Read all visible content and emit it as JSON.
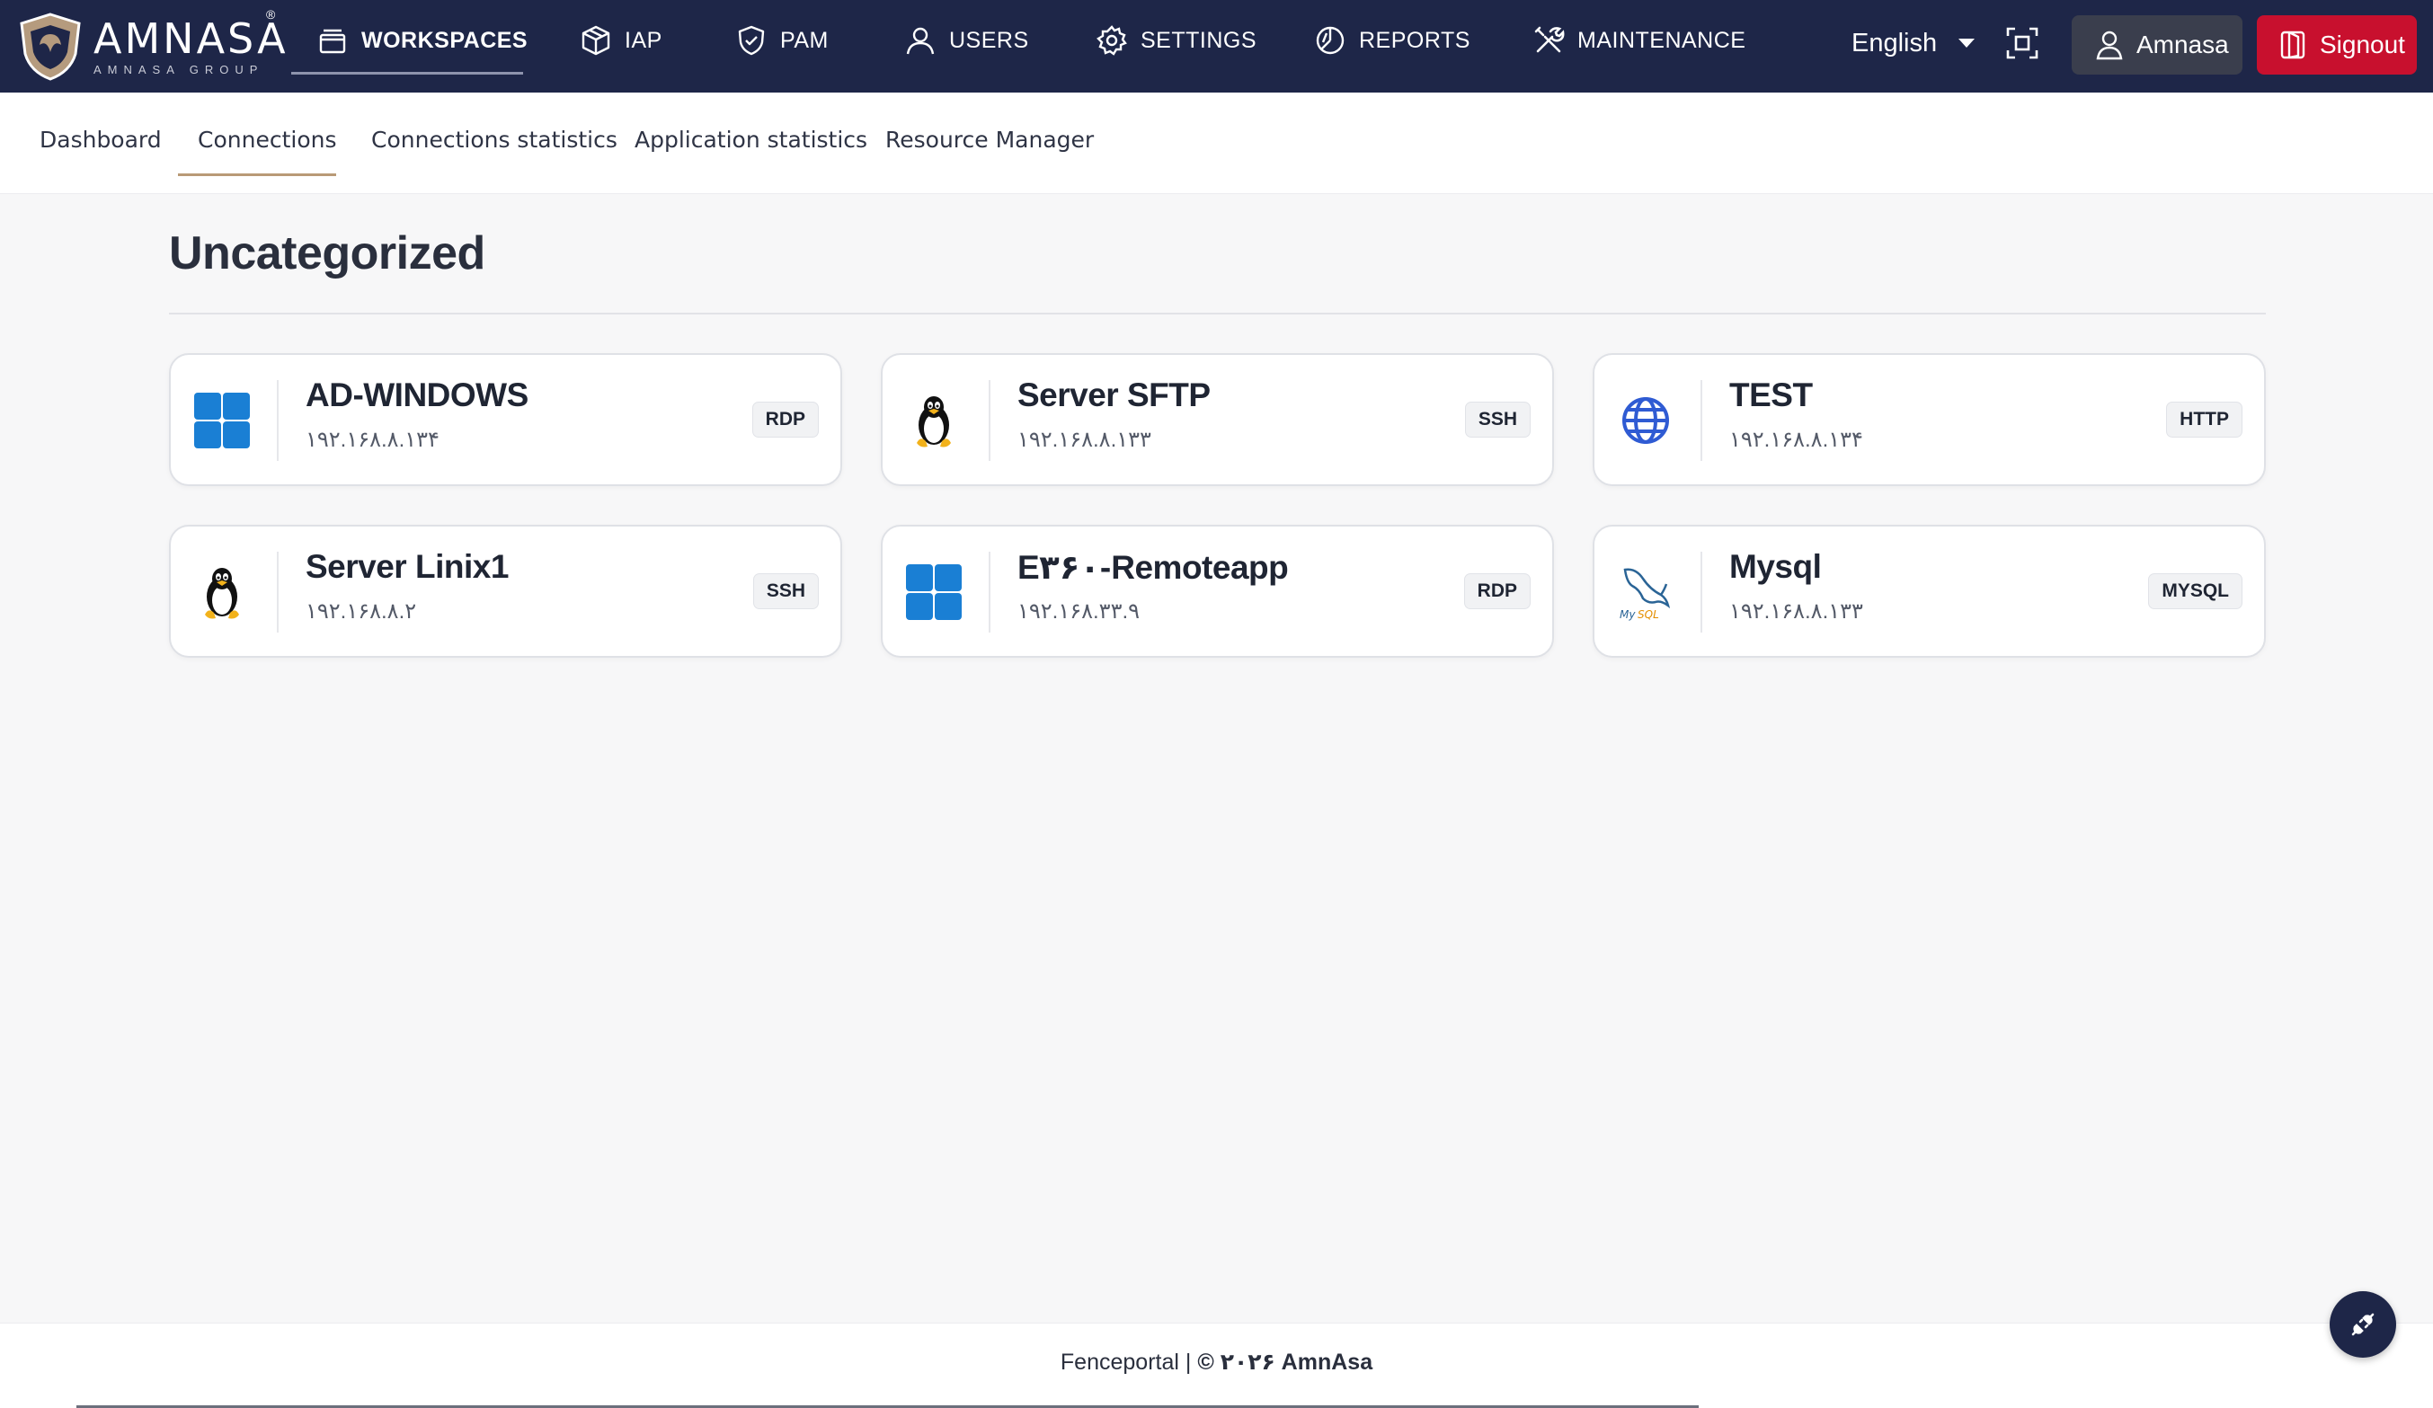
{
  "brand": {
    "name": "AMNASA",
    "tagline": "AMNASA GROUP",
    "reg_mark": "®"
  },
  "topnav": {
    "items": [
      {
        "label": "WORKSPACES",
        "icon": "window-stack-icon",
        "active": true
      },
      {
        "label": "IAP",
        "icon": "cube-icon",
        "active": false
      },
      {
        "label": "PAM",
        "icon": "shield-check-icon",
        "active": false
      },
      {
        "label": "USERS",
        "icon": "user-icon",
        "active": false
      },
      {
        "label": "SETTINGS",
        "icon": "gear-icon",
        "active": false
      },
      {
        "label": "REPORTS",
        "icon": "pie-chart-icon",
        "active": false
      },
      {
        "label": "MAINTENANCE",
        "icon": "tools-icon",
        "active": false
      }
    ],
    "language": "English",
    "user_label": "Amnasa",
    "signout_label": "Signout"
  },
  "subnav": {
    "tabs": [
      {
        "label": "Dashboard",
        "active": false
      },
      {
        "label": "Connections",
        "active": true
      },
      {
        "label": "Connections statistics",
        "active": false
      },
      {
        "label": "Application statistics",
        "active": false
      },
      {
        "label": "Resource Manager",
        "active": false
      }
    ]
  },
  "main": {
    "section_title": "Uncategorized",
    "connections": [
      {
        "name": "AD-WINDOWS",
        "ip": "۱۹۲.۱۶۸.۸.۱۳۴",
        "protocol": "RDP",
        "icon": "windows-icon"
      },
      {
        "name": "Server SFTP",
        "ip": "۱۹۲.۱۶۸.۸.۱۳۳",
        "protocol": "SSH",
        "icon": "linux-penguin-icon"
      },
      {
        "name": "TEST",
        "ip": "۱۹۲.۱۶۸.۸.۱۳۴",
        "protocol": "HTTP",
        "icon": "globe-icon"
      },
      {
        "name": "Server Linix1",
        "ip": "۱۹۲.۱۶۸.۸.۲",
        "protocol": "SSH",
        "icon": "linux-penguin-icon"
      },
      {
        "name": "E۳۶۰-Remoteapp",
        "ip": "۱۹۲.۱۶۸.۳۳.۹",
        "protocol": "RDP",
        "icon": "windows-icon"
      },
      {
        "name": "Mysql",
        "ip": "۱۹۲.۱۶۸.۸.۱۳۳",
        "protocol": "MYSQL",
        "icon": "mysql-dolphin-icon"
      }
    ]
  },
  "footer": {
    "product": "Fenceportal",
    "separator": " | ",
    "copyright": "© ۲۰۲۶ AmnAsa"
  },
  "colors": {
    "topbar_bg": "#1e2648",
    "signout_bg": "#c8102e",
    "user_btn_bg": "#3a3e4d",
    "tab_underline": "#b99a76",
    "windows_blue": "#1a7fd4"
  }
}
